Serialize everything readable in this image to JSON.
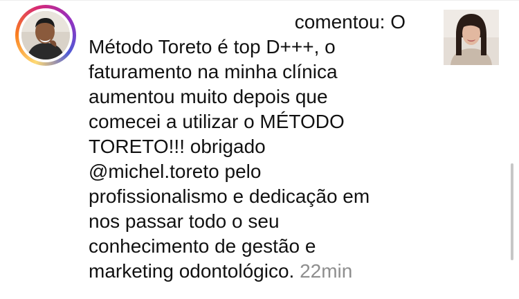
{
  "notification": {
    "verb": "comentou: O",
    "comment_lines": [
      "Método Toreto é top D+++, o",
      "faturamento na minha clínica",
      "aumentou muito depois que",
      "comecei a utilizar o MÉTODO",
      "TORETO!!! obrigado",
      "@michel.toreto  pelo",
      "profissionalismo e dedicação em",
      "nos passar todo o seu",
      "conhecimento de gestão e"
    ],
    "last_line": "marketing odontológico.",
    "time": "22min",
    "avatar_icon": "profile-photo-man-icon",
    "thumbnail_icon": "post-thumbnail-woman-icon",
    "story_ring_colors": [
      "#feda75",
      "#fa7e1e",
      "#d62976",
      "#962fbf",
      "#4f5bd5"
    ]
  }
}
